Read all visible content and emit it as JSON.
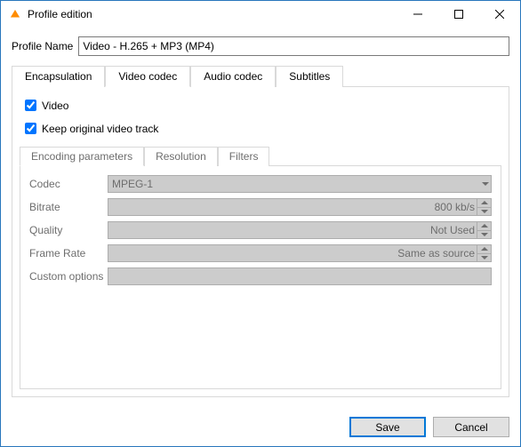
{
  "window": {
    "title": "Profile edition"
  },
  "profile": {
    "label": "Profile Name",
    "value": "Video - H.265 + MP3 (MP4)"
  },
  "tabs": {
    "outer": [
      {
        "label": "Encapsulation",
        "active": false
      },
      {
        "label": "Video codec",
        "active": true
      },
      {
        "label": "Audio codec",
        "active": false
      },
      {
        "label": "Subtitles",
        "active": false
      }
    ],
    "inner": [
      {
        "label": "Encoding parameters",
        "active": true
      },
      {
        "label": "Resolution",
        "active": false
      },
      {
        "label": "Filters",
        "active": false
      }
    ]
  },
  "checks": {
    "video": "Video",
    "keep": "Keep original video track"
  },
  "form": {
    "codec": {
      "label": "Codec",
      "value": "MPEG-1"
    },
    "bitrate": {
      "label": "Bitrate",
      "value": "800 kb/s"
    },
    "quality": {
      "label": "Quality",
      "value": "Not Used"
    },
    "framerate": {
      "label": "Frame Rate",
      "value": "Same as source"
    },
    "custom": {
      "label": "Custom options",
      "value": ""
    }
  },
  "buttons": {
    "save": "Save",
    "cancel": "Cancel"
  },
  "colors": {
    "accent": "#0078d7",
    "titlebar_hover_close": "#e81123"
  }
}
